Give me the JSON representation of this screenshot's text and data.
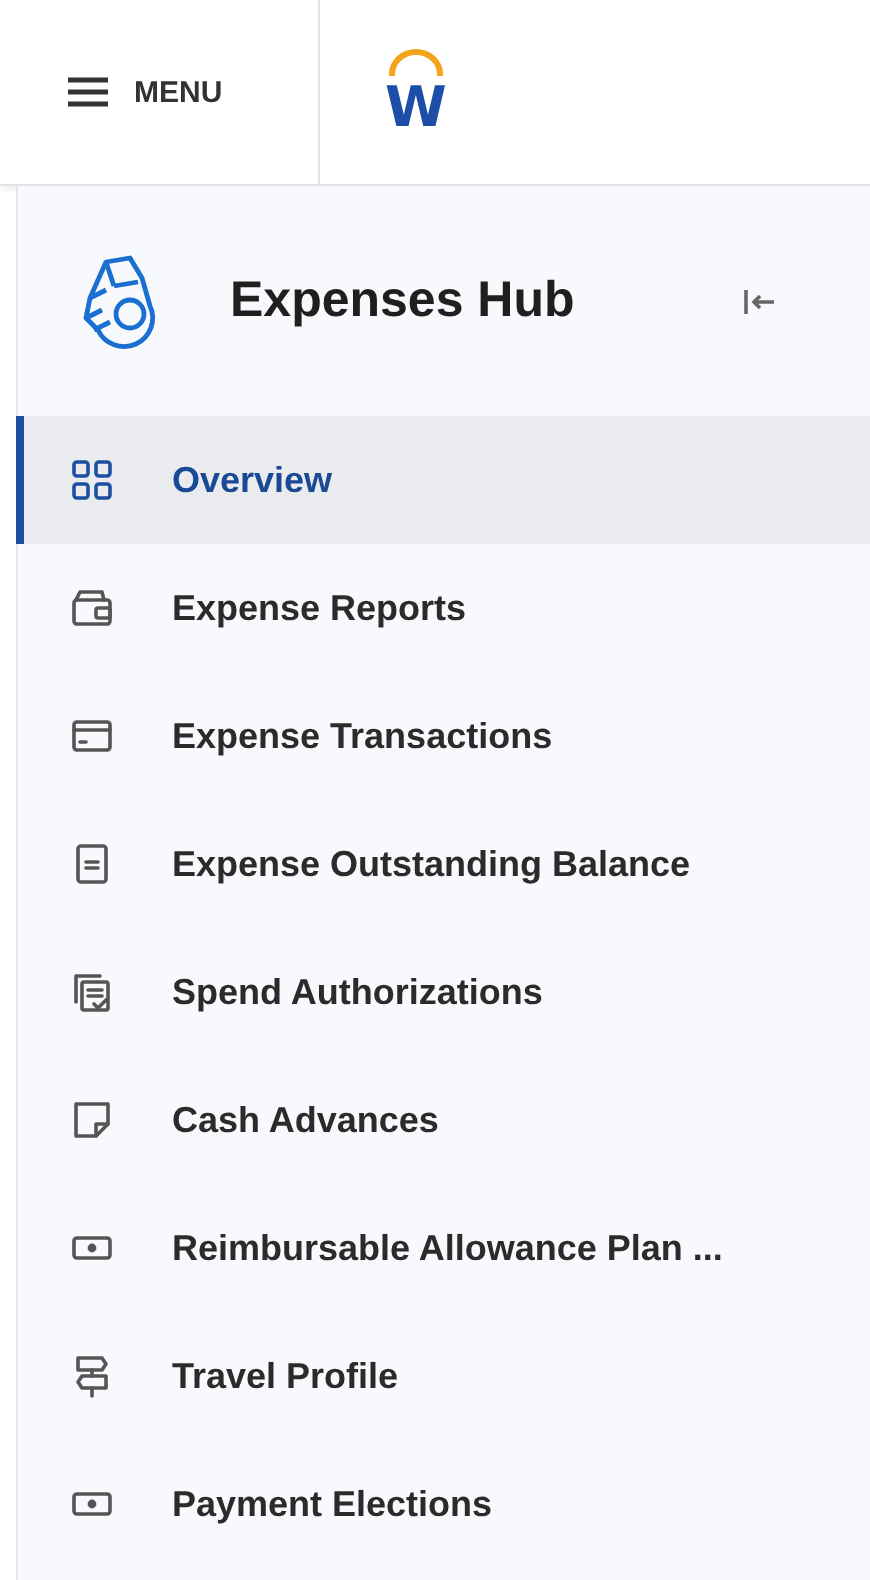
{
  "header": {
    "menu_label": "MENU",
    "logo_letter": "W"
  },
  "hub": {
    "title": "Expenses Hub"
  },
  "items": [
    {
      "label": "Overview",
      "kind": "grid",
      "selected": true
    },
    {
      "label": "Expense Reports",
      "kind": "wallet",
      "selected": false
    },
    {
      "label": "Expense Transactions",
      "kind": "card",
      "selected": false
    },
    {
      "label": "Expense Outstanding Balance",
      "kind": "document",
      "selected": false
    },
    {
      "label": "Spend Authorizations",
      "kind": "receipt",
      "selected": false
    },
    {
      "label": "Cash Advances",
      "kind": "note",
      "selected": false
    },
    {
      "label": "Reimbursable Allowance Plan ...",
      "kind": "cash",
      "selected": false
    },
    {
      "label": "Travel Profile",
      "kind": "signpost",
      "selected": false
    },
    {
      "label": "Payment Elections",
      "kind": "cash",
      "selected": false
    }
  ]
}
